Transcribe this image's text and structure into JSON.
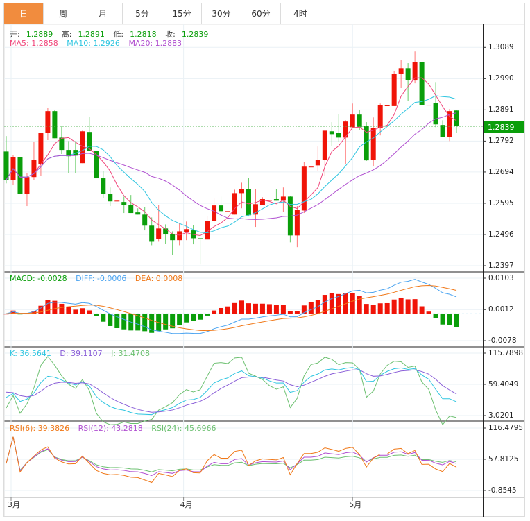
{
  "tabs": [
    {
      "label": "日",
      "active": true
    },
    {
      "label": "周"
    },
    {
      "label": "月"
    },
    {
      "label": "5分"
    },
    {
      "label": "15分"
    },
    {
      "label": "30分"
    },
    {
      "label": "60分"
    },
    {
      "label": "4时"
    }
  ],
  "ohlc_legend": {
    "open_label": "开:",
    "open": "1.2889",
    "high_label": "高:",
    "high": "1.2891",
    "low_label": "低:",
    "low": "1.2818",
    "close_label": "收:",
    "close": "1.2839"
  },
  "ma_legend": {
    "ma5": "MA5: 1.2858",
    "ma10": "MA10: 1.2926",
    "ma20": "MA20: 1.2883"
  },
  "macd_legend": {
    "macd": "MACD: -0.0028",
    "diff": "DIFF: -0.0006",
    "dea": "DEA: 0.0008"
  },
  "kdj_legend": {
    "k": "K: 36.5641",
    "d": "D: 39.1107",
    "j": "J: 31.4708"
  },
  "rsi_legend": {
    "rsi6": "RSI(6): 39.3826",
    "rsi12": "RSI(12): 43.2818",
    "rsi24": "RSI(24): 45.6966"
  },
  "current_price": "1.2839",
  "colors": {
    "up": "#f01408",
    "down": "#0a9e0a",
    "ma5": "#f0457a",
    "ma10": "#2ec5e0",
    "ma20": "#b04fd0",
    "diff": "#4aa3f0",
    "dea": "#f07818",
    "k": "#2ec5e0",
    "d": "#8a5ed8",
    "j": "#6cc070",
    "rsi6": "#f07818",
    "rsi12": "#b04fd0",
    "rsi24": "#6cc070",
    "accent": "#f18c3e"
  },
  "chart_data": {
    "type": "candlestick",
    "price_axis": {
      "range": [
        1.2397,
        1.3089
      ],
      "ticks": [
        "1.3089",
        "1.2990",
        "1.2891",
        "1.2792",
        "1.2694",
        "1.2595",
        "1.2496",
        "1.2397"
      ]
    },
    "macd_axis": {
      "range": [
        -0.0078,
        0.0103
      ],
      "ticks": [
        "0.0103",
        "0.0012",
        "-0.0078"
      ]
    },
    "kdj_axis": {
      "range": [
        3.0201,
        115.7898
      ],
      "ticks": [
        "115.7898",
        "59.4049",
        "3.0201"
      ]
    },
    "rsi_axis": {
      "range": [
        -0.8545,
        116.4795
      ],
      "ticks": [
        "116.4795",
        "57.8125",
        "-0.8545"
      ]
    },
    "date_labels": [
      {
        "label": "3月",
        "index": 0.7
      },
      {
        "label": "4月",
        "index": 25.6
      },
      {
        "label": "5月",
        "index": 50
      }
    ],
    "ohlc": [
      [
        1.2759,
        1.2808,
        1.2658,
        1.2669
      ],
      [
        1.2669,
        1.2748,
        1.2652,
        1.274
      ],
      [
        1.274,
        1.2742,
        1.2625,
        1.2625
      ],
      [
        1.2625,
        1.2691,
        1.2586,
        1.2678
      ],
      [
        1.2678,
        1.279,
        1.2669,
        1.2733
      ],
      [
        1.2718,
        1.2819,
        1.2682,
        1.2819
      ],
      [
        1.2817,
        1.2898,
        1.2795,
        1.2887
      ],
      [
        1.2887,
        1.2891,
        1.2801,
        1.2801
      ],
      [
        1.2803,
        1.2841,
        1.2751,
        1.2764
      ],
      [
        1.2764,
        1.2792,
        1.2691,
        1.2744
      ],
      [
        1.2764,
        1.2792,
        1.2691,
        1.2746
      ],
      [
        1.2722,
        1.2825,
        1.2722,
        1.2823
      ],
      [
        1.2821,
        1.2869,
        1.2762,
        1.2762
      ],
      [
        1.2762,
        1.2762,
        1.2674,
        1.2674
      ],
      [
        1.2674,
        1.2696,
        1.2612,
        1.2625
      ],
      [
        1.2625,
        1.2645,
        1.2586,
        1.2601
      ],
      [
        1.2601,
        1.2603,
        1.2601,
        1.2603
      ],
      [
        1.2599,
        1.2616,
        1.2564,
        1.259
      ],
      [
        1.259,
        1.2621,
        1.2564,
        1.2564
      ],
      [
        1.2566,
        1.2579,
        1.2559,
        1.2559
      ],
      [
        1.2559,
        1.2583,
        1.2509,
        1.2524
      ],
      [
        1.2524,
        1.255,
        1.2462,
        1.2473
      ],
      [
        1.2482,
        1.259,
        1.2473,
        1.2515
      ],
      [
        1.2515,
        1.2528,
        1.2467,
        1.2498
      ],
      [
        1.2498,
        1.2506,
        1.243,
        1.2478
      ],
      [
        1.2478,
        1.2531,
        1.2462,
        1.2506
      ],
      [
        1.2504,
        1.2537,
        1.2478,
        1.2513
      ],
      [
        1.2509,
        1.2526,
        1.2465,
        1.2484
      ],
      [
        1.2484,
        1.2484,
        1.2401,
        1.2482
      ],
      [
        1.248,
        1.2555,
        1.248,
        1.2539
      ],
      [
        1.2539,
        1.261,
        1.2531,
        1.2588
      ],
      [
        1.2588,
        1.2616,
        1.2564,
        1.257
      ],
      [
        1.2568,
        1.257,
        1.2568,
        1.257
      ],
      [
        1.2559,
        1.2638,
        1.2559,
        1.2627
      ],
      [
        1.2627,
        1.266,
        1.2579,
        1.2641
      ],
      [
        1.2641,
        1.2674,
        1.2553,
        1.2557
      ],
      [
        1.2559,
        1.2641,
        1.252,
        1.2592
      ],
      [
        1.259,
        1.2614,
        1.259,
        1.2608
      ],
      [
        1.2603,
        1.2605,
        1.2603,
        1.2605
      ],
      [
        1.2608,
        1.2641,
        1.2603,
        1.2603
      ],
      [
        1.2603,
        1.2645,
        1.2568,
        1.2616
      ],
      [
        1.2616,
        1.2619,
        1.2471,
        1.2493
      ],
      [
        1.2493,
        1.2586,
        1.2456,
        1.2575
      ],
      [
        1.2572,
        1.2726,
        1.2564,
        1.2711
      ],
      [
        1.2709,
        1.2711,
        1.2709,
        1.2711
      ],
      [
        1.2715,
        1.2775,
        1.2696,
        1.2733
      ],
      [
        1.2733,
        1.2825,
        1.2682,
        1.2825
      ],
      [
        1.2823,
        1.2852,
        1.2777,
        1.2814
      ],
      [
        1.2817,
        1.2878,
        1.279,
        1.2803
      ],
      [
        1.2803,
        1.2858,
        1.2718,
        1.2854
      ],
      [
        1.2836,
        1.2911,
        1.2836,
        1.2876
      ],
      [
        1.2876,
        1.2891,
        1.2828,
        1.2836
      ],
      [
        1.2839,
        1.2852,
        1.2729,
        1.2731
      ],
      [
        1.2733,
        1.2867,
        1.2713,
        1.2834
      ],
      [
        1.2834,
        1.2911,
        1.281,
        1.2905
      ],
      [
        1.2903,
        1.2905,
        1.2903,
        1.2905
      ],
      [
        1.2903,
        1.3015,
        1.2903,
        1.3006
      ],
      [
        1.3004,
        1.305,
        1.296,
        1.3023
      ],
      [
        1.3023,
        1.3039,
        1.292,
        1.2986
      ],
      [
        1.2984,
        1.3076,
        1.2975,
        1.3043
      ],
      [
        1.3043,
        1.3043,
        1.2905,
        1.2905
      ],
      [
        1.2905,
        1.2907,
        1.2905,
        1.2907
      ],
      [
        1.2913,
        1.2979,
        1.2836,
        1.2845
      ],
      [
        1.2843,
        1.2858,
        1.2806,
        1.2806
      ],
      [
        1.2806,
        1.2894,
        1.2792,
        1.2887
      ],
      [
        1.2889,
        1.2891,
        1.2818,
        1.2839
      ]
    ]
  }
}
